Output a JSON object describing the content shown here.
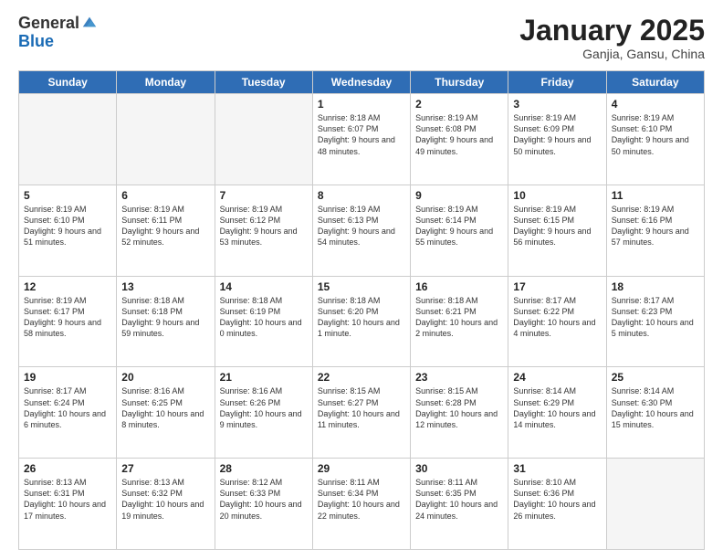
{
  "header": {
    "logo_general": "General",
    "logo_blue": "Blue",
    "month_title": "January 2025",
    "subtitle": "Ganjia, Gansu, China"
  },
  "days_of_week": [
    "Sunday",
    "Monday",
    "Tuesday",
    "Wednesday",
    "Thursday",
    "Friday",
    "Saturday"
  ],
  "weeks": [
    [
      {
        "day": null,
        "empty": true
      },
      {
        "day": null,
        "empty": true
      },
      {
        "day": null,
        "empty": true
      },
      {
        "day": "1",
        "sunrise": "8:18 AM",
        "sunset": "6:07 PM",
        "daylight": "9 hours and 48 minutes."
      },
      {
        "day": "2",
        "sunrise": "8:19 AM",
        "sunset": "6:08 PM",
        "daylight": "9 hours and 49 minutes."
      },
      {
        "day": "3",
        "sunrise": "8:19 AM",
        "sunset": "6:09 PM",
        "daylight": "9 hours and 50 minutes."
      },
      {
        "day": "4",
        "sunrise": "8:19 AM",
        "sunset": "6:10 PM",
        "daylight": "9 hours and 50 minutes."
      }
    ],
    [
      {
        "day": "5",
        "sunrise": "8:19 AM",
        "sunset": "6:10 PM",
        "daylight": "9 hours and 51 minutes."
      },
      {
        "day": "6",
        "sunrise": "8:19 AM",
        "sunset": "6:11 PM",
        "daylight": "9 hours and 52 minutes."
      },
      {
        "day": "7",
        "sunrise": "8:19 AM",
        "sunset": "6:12 PM",
        "daylight": "9 hours and 53 minutes."
      },
      {
        "day": "8",
        "sunrise": "8:19 AM",
        "sunset": "6:13 PM",
        "daylight": "9 hours and 54 minutes."
      },
      {
        "day": "9",
        "sunrise": "8:19 AM",
        "sunset": "6:14 PM",
        "daylight": "9 hours and 55 minutes."
      },
      {
        "day": "10",
        "sunrise": "8:19 AM",
        "sunset": "6:15 PM",
        "daylight": "9 hours and 56 minutes."
      },
      {
        "day": "11",
        "sunrise": "8:19 AM",
        "sunset": "6:16 PM",
        "daylight": "9 hours and 57 minutes."
      }
    ],
    [
      {
        "day": "12",
        "sunrise": "8:19 AM",
        "sunset": "6:17 PM",
        "daylight": "9 hours and 58 minutes."
      },
      {
        "day": "13",
        "sunrise": "8:18 AM",
        "sunset": "6:18 PM",
        "daylight": "9 hours and 59 minutes."
      },
      {
        "day": "14",
        "sunrise": "8:18 AM",
        "sunset": "6:19 PM",
        "daylight": "10 hours and 0 minutes."
      },
      {
        "day": "15",
        "sunrise": "8:18 AM",
        "sunset": "6:20 PM",
        "daylight": "10 hours and 1 minute."
      },
      {
        "day": "16",
        "sunrise": "8:18 AM",
        "sunset": "6:21 PM",
        "daylight": "10 hours and 2 minutes."
      },
      {
        "day": "17",
        "sunrise": "8:17 AM",
        "sunset": "6:22 PM",
        "daylight": "10 hours and 4 minutes."
      },
      {
        "day": "18",
        "sunrise": "8:17 AM",
        "sunset": "6:23 PM",
        "daylight": "10 hours and 5 minutes."
      }
    ],
    [
      {
        "day": "19",
        "sunrise": "8:17 AM",
        "sunset": "6:24 PM",
        "daylight": "10 hours and 6 minutes."
      },
      {
        "day": "20",
        "sunrise": "8:16 AM",
        "sunset": "6:25 PM",
        "daylight": "10 hours and 8 minutes."
      },
      {
        "day": "21",
        "sunrise": "8:16 AM",
        "sunset": "6:26 PM",
        "daylight": "10 hours and 9 minutes."
      },
      {
        "day": "22",
        "sunrise": "8:15 AM",
        "sunset": "6:27 PM",
        "daylight": "10 hours and 11 minutes."
      },
      {
        "day": "23",
        "sunrise": "8:15 AM",
        "sunset": "6:28 PM",
        "daylight": "10 hours and 12 minutes."
      },
      {
        "day": "24",
        "sunrise": "8:14 AM",
        "sunset": "6:29 PM",
        "daylight": "10 hours and 14 minutes."
      },
      {
        "day": "25",
        "sunrise": "8:14 AM",
        "sunset": "6:30 PM",
        "daylight": "10 hours and 15 minutes."
      }
    ],
    [
      {
        "day": "26",
        "sunrise": "8:13 AM",
        "sunset": "6:31 PM",
        "daylight": "10 hours and 17 minutes."
      },
      {
        "day": "27",
        "sunrise": "8:13 AM",
        "sunset": "6:32 PM",
        "daylight": "10 hours and 19 minutes."
      },
      {
        "day": "28",
        "sunrise": "8:12 AM",
        "sunset": "6:33 PM",
        "daylight": "10 hours and 20 minutes."
      },
      {
        "day": "29",
        "sunrise": "8:11 AM",
        "sunset": "6:34 PM",
        "daylight": "10 hours and 22 minutes."
      },
      {
        "day": "30",
        "sunrise": "8:11 AM",
        "sunset": "6:35 PM",
        "daylight": "10 hours and 24 minutes."
      },
      {
        "day": "31",
        "sunrise": "8:10 AM",
        "sunset": "6:36 PM",
        "daylight": "10 hours and 26 minutes."
      },
      {
        "day": null,
        "empty": true
      }
    ]
  ]
}
